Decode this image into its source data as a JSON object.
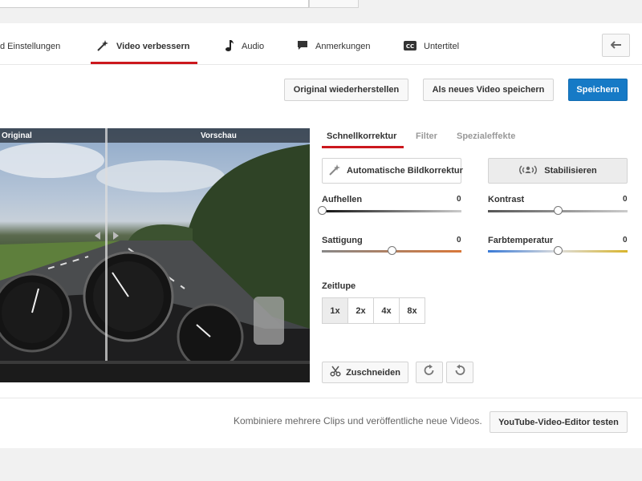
{
  "tabs": [
    {
      "label": "d Einstellungen"
    },
    {
      "label": "Video verbessern"
    },
    {
      "label": "Audio"
    },
    {
      "label": "Anmerkungen"
    },
    {
      "label": "Untertitel"
    }
  ],
  "actions": {
    "restore_label": "Original wiederherstellen",
    "save_new_label": "Als neues Video speichern",
    "save_label": "Speichern"
  },
  "video": {
    "original_label": "Original",
    "preview_label": "Vorschau"
  },
  "panel": {
    "tabs": [
      "Schnellkorrektur",
      "Filter",
      "Spezialeffekte"
    ],
    "auto_label": "Automatische Bildkorrektur",
    "stabilize_label": "Stabilisieren",
    "sliders": [
      {
        "label": "Aufhellen",
        "value": "0",
        "position": 0.0
      },
      {
        "label": "Kontrast",
        "value": "0",
        "position": 0.5
      },
      {
        "label": "Sattigung",
        "value": "0",
        "position": 0.5
      },
      {
        "label": "Farbtemperatur",
        "value": "0",
        "position": 0.5
      }
    ],
    "slowmo_label": "Zeitlupe",
    "speeds": [
      "1x",
      "2x",
      "4x",
      "8x"
    ],
    "selected_speed": "1x",
    "crop_label": "Zuschneiden"
  },
  "footer": {
    "text": "Kombiniere mehrere Clips und veröffentliche neue Videos.",
    "editor_label": "YouTube-Video-Editor testen"
  },
  "colors": {
    "accent": "#cc181e",
    "primary_button": "#167ac6"
  }
}
